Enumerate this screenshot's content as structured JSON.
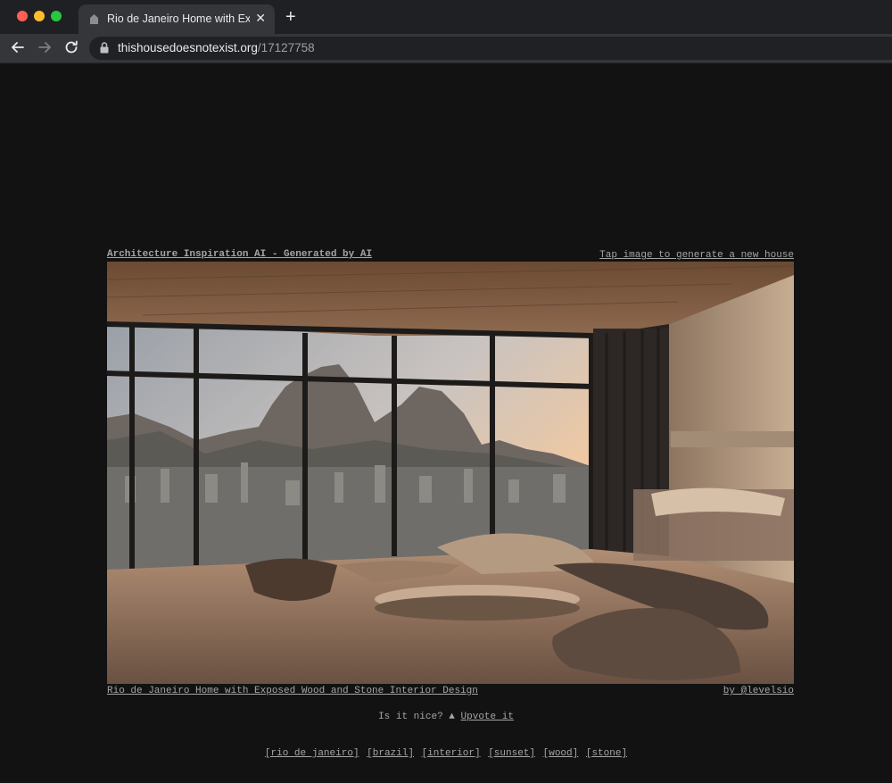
{
  "browser": {
    "tab_title": "Rio de Janeiro Home with Exposed Wood and Stone Interior Design",
    "tab_close": "✕",
    "new_tab": "+",
    "url_host": "thishousedoesnotexist.org",
    "url_path": "/17127758"
  },
  "page": {
    "heading": "Architecture Inspiration AI - Generated by AI",
    "tap_hint": "Tap image to generate a new house",
    "caption": "Rio de Janeiro Home with Exposed Wood and Stone Interior Design",
    "credit": "by @levelsio",
    "vote_prompt": "Is it nice?",
    "vote_arrow": "▲",
    "vote_link": "Upvote it",
    "tags": [
      "[rio de janeiro]",
      "[brazil]",
      "[interior]",
      "[sunset]",
      "[wood]",
      "[stone]"
    ]
  }
}
